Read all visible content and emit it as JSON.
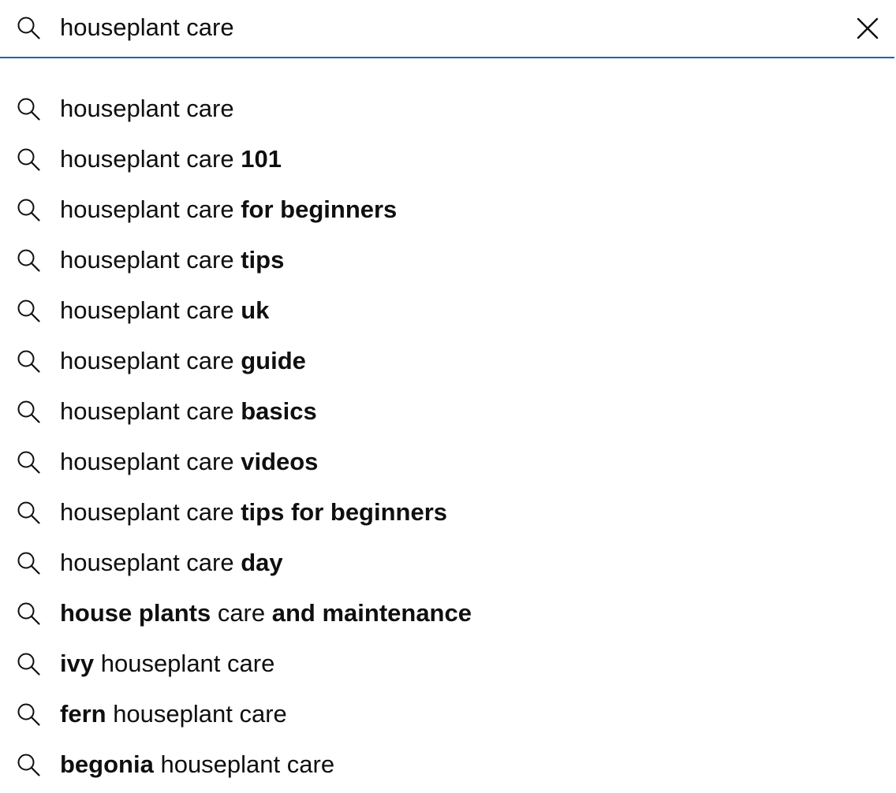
{
  "search": {
    "value": "houseplant care",
    "icon": "search-icon",
    "clear_icon": "close-icon",
    "accent_color": "#1c62b9"
  },
  "suggestions": [
    {
      "parts": [
        {
          "text": "houseplant care",
          "bold": false
        }
      ]
    },
    {
      "parts": [
        {
          "text": "houseplant care ",
          "bold": false
        },
        {
          "text": "101",
          "bold": true
        }
      ]
    },
    {
      "parts": [
        {
          "text": "houseplant care ",
          "bold": false
        },
        {
          "text": "for beginners",
          "bold": true
        }
      ]
    },
    {
      "parts": [
        {
          "text": "houseplant care ",
          "bold": false
        },
        {
          "text": "tips",
          "bold": true
        }
      ]
    },
    {
      "parts": [
        {
          "text": "houseplant care ",
          "bold": false
        },
        {
          "text": "uk",
          "bold": true
        }
      ]
    },
    {
      "parts": [
        {
          "text": "houseplant care ",
          "bold": false
        },
        {
          "text": "guide",
          "bold": true
        }
      ]
    },
    {
      "parts": [
        {
          "text": "houseplant care ",
          "bold": false
        },
        {
          "text": "basics",
          "bold": true
        }
      ]
    },
    {
      "parts": [
        {
          "text": "houseplant care ",
          "bold": false
        },
        {
          "text": "videos",
          "bold": true
        }
      ]
    },
    {
      "parts": [
        {
          "text": "houseplant care ",
          "bold": false
        },
        {
          "text": "tips for beginners",
          "bold": true
        }
      ]
    },
    {
      "parts": [
        {
          "text": "houseplant care ",
          "bold": false
        },
        {
          "text": "day",
          "bold": true
        }
      ]
    },
    {
      "parts": [
        {
          "text": "house plants",
          "bold": true
        },
        {
          "text": " care ",
          "bold": false
        },
        {
          "text": "and maintenance",
          "bold": true
        }
      ]
    },
    {
      "parts": [
        {
          "text": "ivy",
          "bold": true
        },
        {
          "text": " houseplant care",
          "bold": false
        }
      ]
    },
    {
      "parts": [
        {
          "text": "fern",
          "bold": true
        },
        {
          "text": " houseplant care",
          "bold": false
        }
      ]
    },
    {
      "parts": [
        {
          "text": "begonia",
          "bold": true
        },
        {
          "text": " houseplant care",
          "bold": false
        }
      ]
    }
  ]
}
